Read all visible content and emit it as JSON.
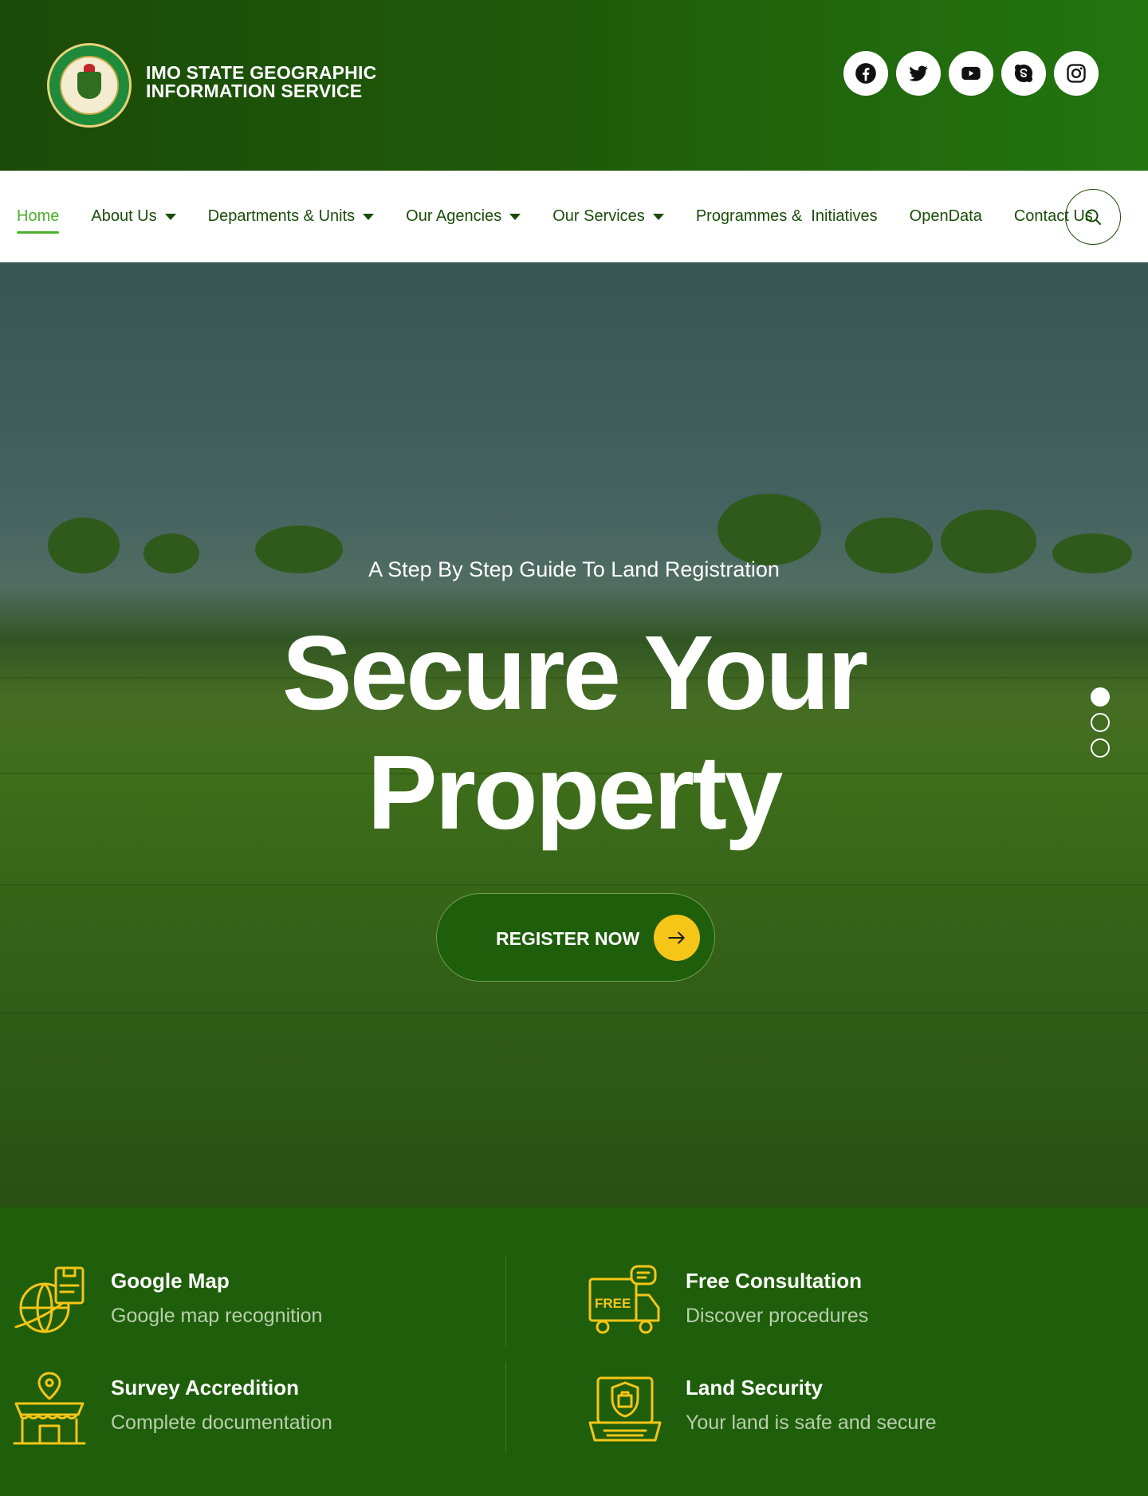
{
  "header": {
    "title_line1": "IMO STATE GEOGRAPHIC",
    "title_line2": "INFORMATION SERVICE",
    "logo": "government-of-imo-state-seal",
    "socials": [
      "facebook-icon",
      "twitter-icon",
      "youtube-icon",
      "skype-icon",
      "instagram-icon"
    ]
  },
  "nav": {
    "items": [
      {
        "label": "Home",
        "dropdown": false,
        "active": true
      },
      {
        "label": "About Us",
        "dropdown": true
      },
      {
        "label": "Departments & Units",
        "dropdown": true
      },
      {
        "label": "Our Agencies",
        "dropdown": true
      },
      {
        "label": "Our Services",
        "dropdown": true
      },
      {
        "label": "Programmes &  Initiatives",
        "dropdown": false
      },
      {
        "label": "OpenData",
        "dropdown": false
      },
      {
        "label": "Contact Us",
        "dropdown": false
      }
    ],
    "search_icon": "search-icon"
  },
  "hero": {
    "subtitle": "A Step By Step Guide To Land Registration",
    "title_line1": "Secure Your",
    "title_line2": "Property",
    "cta_label": "REGISTER NOW",
    "slides": 3,
    "active_slide": 1
  },
  "features": [
    {
      "title": "Google Map",
      "desc": "Google map recognition",
      "icon": "globe-map-icon"
    },
    {
      "title": "Free Consultation",
      "desc": "Discover procedures",
      "icon": "free-truck-icon"
    },
    {
      "title": "Survey Accredition",
      "desc": "Complete documentation",
      "icon": "store-location-icon"
    },
    {
      "title": "Land Security",
      "desc": "Your land is safe and secure",
      "icon": "laptop-shield-icon"
    }
  ],
  "colors": {
    "brand_green": "#1f5e0a",
    "accent_yellow": "#f5c518",
    "nav_active": "#4caf2a"
  }
}
